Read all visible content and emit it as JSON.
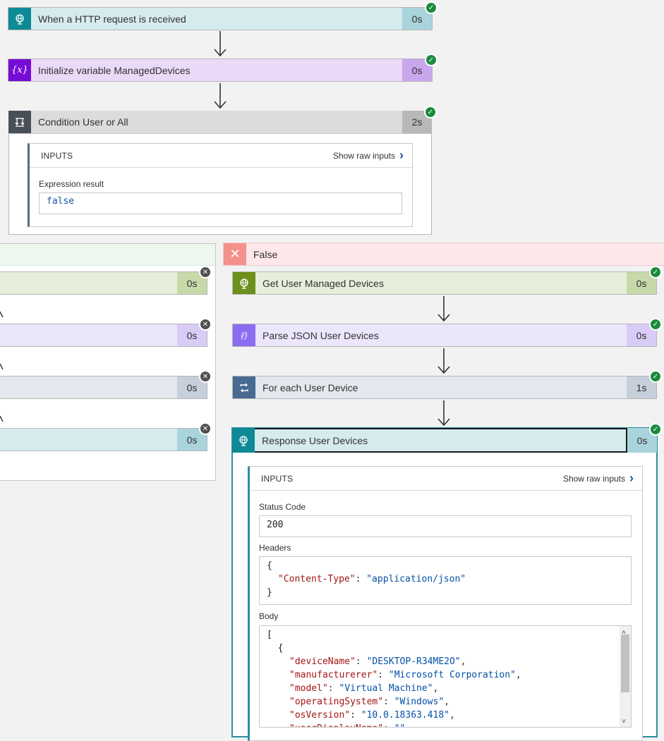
{
  "steps": {
    "http": {
      "title": "When a HTTP request is received",
      "duration": "0s"
    },
    "initvar": {
      "title": "Initialize variable ManagedDevices",
      "duration": "0s"
    },
    "condition": {
      "title": "Condition User or All",
      "duration": "2s"
    }
  },
  "condition_inputs": {
    "header": "INPUTS",
    "show_raw": "Show raw inputs",
    "expression_label": "Expression result",
    "expression_value": "false"
  },
  "true_branch": {
    "durations": [
      "0s",
      "0s",
      "0s",
      "0s"
    ]
  },
  "false_branch": {
    "label": "False",
    "steps": [
      {
        "title": "Get User Managed Devices",
        "duration": "0s"
      },
      {
        "title": "Parse JSON User Devices",
        "duration": "0s"
      },
      {
        "title": "For each User Device",
        "duration": "1s"
      },
      {
        "title": "Response User Devices",
        "duration": "0s"
      }
    ]
  },
  "response_inputs": {
    "header": "INPUTS",
    "show_raw": "Show raw inputs",
    "status_label": "Status Code",
    "status_value": "200",
    "headers_label": "Headers",
    "headers_open": "{",
    "headers_key": "\"Content-Type\"",
    "headers_sep": ": ",
    "headers_value": "\"application/json\"",
    "headers_close": "}",
    "body_label": "Body",
    "body_lines": [
      {
        "text": "[",
        "kind": "punct"
      },
      {
        "text": "  {",
        "kind": "punct"
      },
      {
        "key": "\"deviceName\"",
        "value": "\"DESKTOP-R34ME2O\""
      },
      {
        "key": "\"manufacturerer\"",
        "value": "\"Microsoft Corporation\""
      },
      {
        "key": "\"model\"",
        "value": "\"Virtual Machine\""
      },
      {
        "key": "\"operatingSystem\"",
        "value": "\"Windows\""
      },
      {
        "key": "\"osVersion\"",
        "value": "\"10.0.18363.418\""
      },
      {
        "key": "\"userDisplayName\"",
        "value": "\"\""
      }
    ]
  },
  "colors": {
    "http": "#0e8a96",
    "variable": "#770bd6",
    "condition": "#484f58",
    "green": "#6d8f1c",
    "parse": "#8c6cf0",
    "foreach": "#486991",
    "check": "#1b8a3e"
  }
}
